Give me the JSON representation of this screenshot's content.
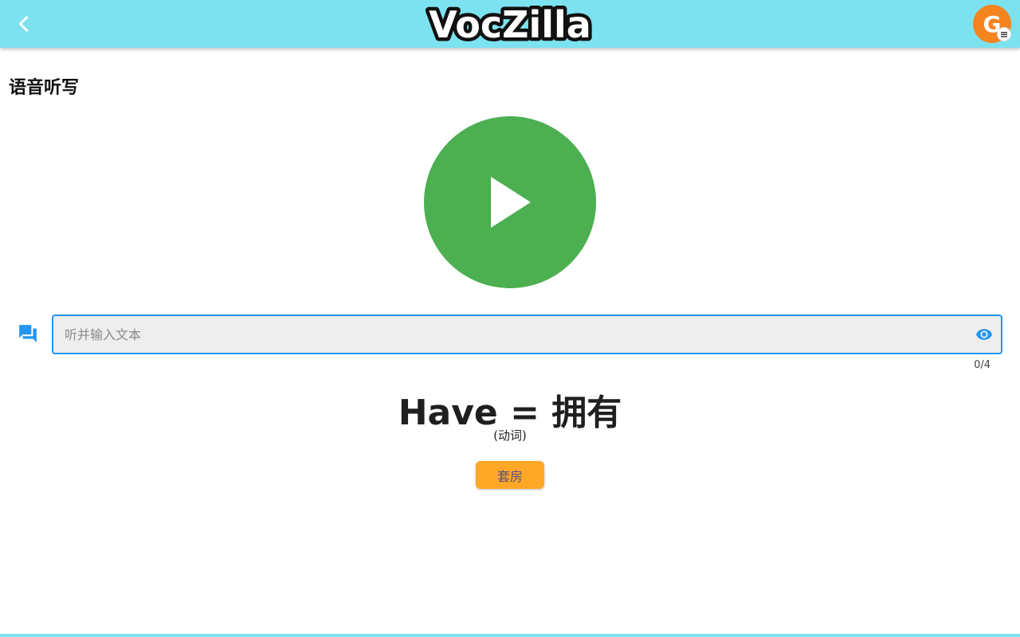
{
  "header": {
    "app_name": "VocZilla",
    "avatar_letter": "G",
    "bar_color": "#7de2f0"
  },
  "page": {
    "title": "语音听写"
  },
  "player": {
    "color": "#4caf50",
    "icon": "play-icon"
  },
  "dictation": {
    "placeholder": "听并输入文本",
    "value": "",
    "counter": "0/4",
    "accent": "#2196f3"
  },
  "word": {
    "display": "Have = 拥有",
    "part_of_speech": "(动词)"
  },
  "tag": {
    "label": "套房",
    "color": "#ffa726"
  }
}
